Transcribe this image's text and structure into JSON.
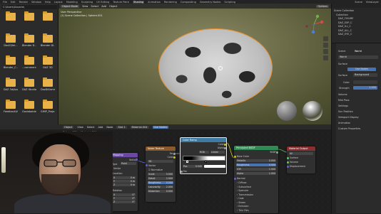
{
  "topbar": {
    "menus": [
      "File",
      "Edit",
      "Render",
      "Window",
      "Help",
      "Layout",
      "Modeling",
      "Sculpting",
      "UV Editing",
      "Texture Paint",
      "Shading",
      "Animation",
      "Rendering",
      "Compositing",
      "Geometry Nodes",
      "Scripting"
    ],
    "active": "Shading",
    "scene": "Scene",
    "view_layer": "ViewLayer"
  },
  "file_browser": {
    "path": "C:\\Users\\Usuario\\",
    "folders": [
      "",
      "",
      "",
      "Dez2\\Del...",
      "Blender D...",
      "Blender Di...",
      "Blender_C...",
      "...commercio...",
      "DAZ 3D",
      "DAZ 3d\\Ass...",
      "DAZ Studio",
      "DazDilliams",
      "Feedback\\Hub",
      "Gaviebaldes",
      "GIMP_Proje..."
    ]
  },
  "viewport": {
    "mode": "Object Mode",
    "menus": [
      "View",
      "Select",
      "Add",
      "Object"
    ],
    "info_line1": "User Perspective",
    "info_line2": "(1) Scene Collection | Sphere.001",
    "options": "Options"
  },
  "outliner": {
    "rows": [
      "Scene Collection",
      "Collection",
      "DAZ_FIGURE",
      "DAZ_EXP_C",
      "DAZ_ILL_C",
      "DAZ_ALL_C",
      "DAZ_EYE_C"
    ]
  },
  "properties": {
    "tabs": [
      "Scene",
      "World"
    ],
    "world_name": "World",
    "surface_label": "Surface",
    "use_nodes": "Use Nodes",
    "surface_value": "Background",
    "color_label": "Color",
    "strength_label": "Strength",
    "strength_value": "1.000",
    "sections": [
      "Volume",
      "Mist Pass",
      "Settings",
      "Sun Position",
      "Viewport Display",
      "Animation",
      "Custom Properties"
    ]
  },
  "node_editor": {
    "header_items": [
      "Object",
      "View",
      "Select",
      "Add",
      "Node"
    ],
    "slot": "Slot 1",
    "use_nodes": "Use Nodes",
    "breadcrumb": "Sphere.001  >  Material.004",
    "material": "Material.004"
  },
  "nodes": {
    "mapping": {
      "title": "Mapping",
      "vector_label": "Vector",
      "type_label": "Type",
      "type_value": "Point",
      "location": "Location",
      "rotation": "Rotation",
      "x": "X",
      "y": "Y",
      "z": "Z",
      "xyz_values": [
        "0 m",
        "0 m",
        "0 m"
      ],
      "rot_values": [
        "0°",
        "0°",
        "0°"
      ]
    },
    "noise": {
      "title": "Noise Texture",
      "fac": "Fac",
      "color": "Color",
      "dimension": "3D",
      "vector": "Vector",
      "normalize": "Normalize",
      "fields": [
        "Scale",
        "Detail",
        "Roughness",
        "Lacunarity",
        "Distortion"
      ],
      "values": [
        "5.000",
        "2.000",
        "0.500",
        "2.000",
        "0.000"
      ]
    },
    "colorramp": {
      "title": "Color Ramp",
      "color": "Color",
      "alpha": "Alpha",
      "mode": "RGB",
      "interp": "Linear",
      "pos_label": "Pos",
      "pos_value": "0.545",
      "fac": "Fac"
    },
    "principled": {
      "title": "Principled BSDF",
      "bsdf": "BSDF",
      "base_color": "Base Color",
      "rows": [
        "Metallic",
        "Roughness",
        "IOR",
        "Alpha"
      ],
      "values": [
        "0.000",
        "0.500",
        "1.500",
        "1.000"
      ],
      "normal": "Normal",
      "sections": [
        "Diffuse",
        "Subsurface",
        "Specular",
        "Transmission",
        "Coat",
        "Sheen",
        "Emission",
        "Thin Film"
      ]
    },
    "output": {
      "title": "Material Output",
      "target": "All",
      "inputs": [
        "Surface",
        "Volume",
        "Displacement"
      ]
    }
  },
  "colors": {
    "accent": "#e8912d",
    "folder": "#e8b248",
    "mapping_header": "#6b48a8",
    "noise_header": "#8a5a2b",
    "ramp_header": "#3f7aa3",
    "principled_header": "#2f8a53",
    "output_header": "#8a2f2f",
    "roughness_field": "#4772b3"
  }
}
